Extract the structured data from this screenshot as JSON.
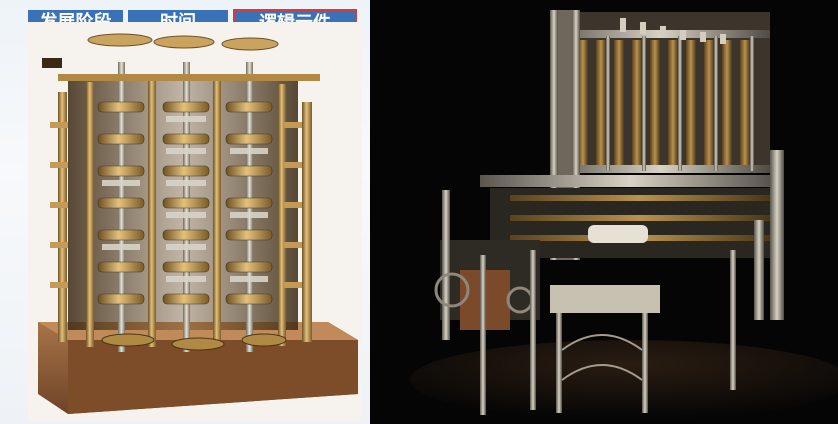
{
  "tabs": [
    {
      "label": "发展阶段"
    },
    {
      "label": "时间"
    },
    {
      "label": "逻辑元件"
    }
  ],
  "images": [
    {
      "subject": "difference-engine-no1-fragment"
    },
    {
      "subject": "difference-engine-no2"
    }
  ],
  "colors": {
    "tab_blue": "#3a72b8",
    "active_tab_border": "#d63a3a",
    "brass": "#b08a45",
    "dark_background": "#050505"
  }
}
